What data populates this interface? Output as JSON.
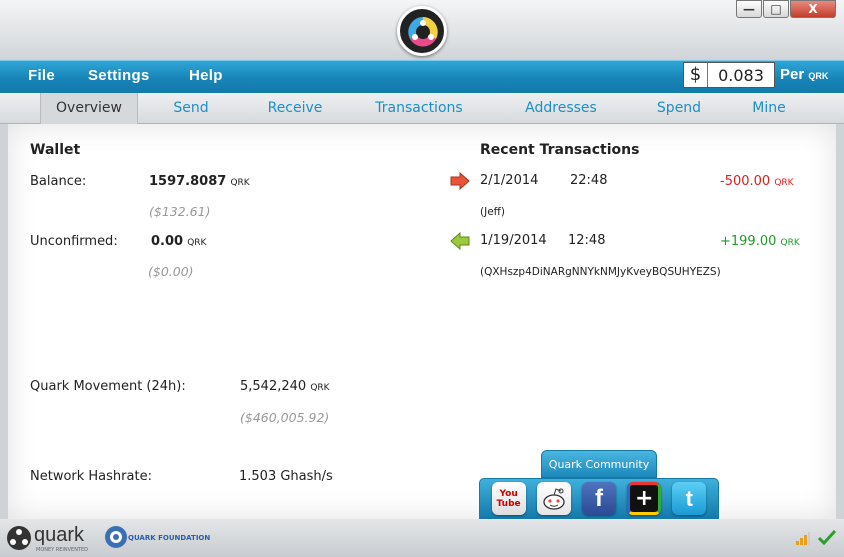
{
  "window": {
    "minimize_label": "—",
    "maximize_label": "□",
    "close_label": "X"
  },
  "menu": {
    "file": "File",
    "settings": "Settings",
    "help": "Help"
  },
  "price": {
    "currency_symbol": "$",
    "value": "0.083",
    "per_label": "Per",
    "unit": "QRK"
  },
  "tabs": [
    {
      "label": "Overview",
      "active": true
    },
    {
      "label": "Send"
    },
    {
      "label": "Receive"
    },
    {
      "label": "Transactions"
    },
    {
      "label": "Addresses"
    },
    {
      "label": "Spend"
    },
    {
      "label": "Mine"
    }
  ],
  "wallet": {
    "title": "Wallet",
    "balance_label": "Balance:",
    "balance_value": "1597.8087",
    "balance_unit": "QRK",
    "balance_usd": "($132.61)",
    "unconfirmed_label": "Unconfirmed:",
    "unconfirmed_value": "0.00",
    "unconfirmed_unit": "QRK",
    "unconfirmed_usd": "($0.00)"
  },
  "recent": {
    "title": "Recent Transactions",
    "items": [
      {
        "date": "2/1/2014",
        "time": "22:48",
        "amount": "-500.00",
        "unit": "QRK",
        "label": "(Jeff)",
        "direction": "sent"
      },
      {
        "date": "1/19/2014",
        "time": "12:48",
        "amount": "+199.00",
        "unit": "QRK",
        "label": "(QXHszp4DiNARgNNYkNMJyKveyBQSUHYEZS)",
        "direction": "received"
      }
    ]
  },
  "stats": {
    "movement_label": "Quark  Movement  (24h):",
    "movement_value": "5,542,240",
    "movement_unit": "QRK",
    "movement_usd": "($460,005.92)",
    "hashrate_label": "Network  Hashrate:",
    "hashrate_value": "1.503  Ghash/s"
  },
  "community": {
    "title": "Quark Community",
    "icons": [
      "youtube-icon",
      "reddit-icon",
      "facebook-icon",
      "google-plus-icon",
      "twitter-icon"
    ],
    "youtube_text": "You Tube",
    "facebook_text": "f",
    "google_text": "+",
    "twitter_text": "t"
  },
  "footer": {
    "brand": "quark",
    "brand_tagline": "MONEY REINVENTED",
    "foundation": "QUARK FOUNDATION"
  },
  "colors": {
    "accent": "#1884b8",
    "link": "#1c8fc3",
    "negative": "#d42020",
    "positive": "#1f9a2a"
  }
}
